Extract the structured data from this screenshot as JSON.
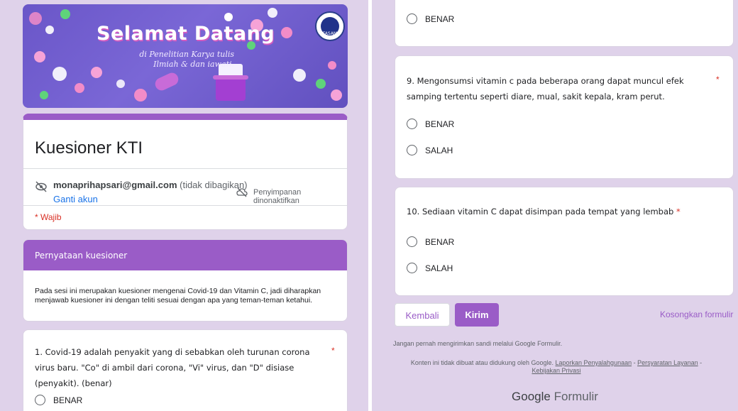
{
  "left": {
    "banner": {
      "title": "Selamat Datang",
      "subtitle": "di Penelitian Karya tulis Ilmiah & dan iawati.",
      "logo_text": "FASAM"
    },
    "form": {
      "title": "Kuesioner KTI",
      "email": "monaprihapsari@gmail.com",
      "shared_note": "(tidak dibagikan)",
      "switch_account": "Ganti akun",
      "save_status": "Penyimpanan dinonaktifkan",
      "required_note": "* Wajib"
    },
    "section": {
      "title": "Pernyataan kuesioner",
      "description": "Pada sesi ini merupakan kuesioner mengenai Covid-19 dan Vitamin C, jadi diharapkan menjawab kuesioner ini dengan teliti sesuai dengan apa yang teman-teman ketahui."
    },
    "question1": {
      "text": "1.   Covid-19 adalah penyakit yang di sebabkan oleh turunan corona virus baru. \"Co\" di ambil dari corona, \"Vi\" virus, dan \"D\" disiase (penyakit). (benar)",
      "required_mark": "*",
      "option1": "BENAR"
    }
  },
  "right": {
    "prev_option": "BENAR",
    "question9": {
      "text": "9.   Mengonsumsi vitamin c pada beberapa orang dapat muncul efek samping tertentu seperti diare, mual, sakit kepala, kram perut.",
      "required_mark": "*",
      "options": [
        "BENAR",
        "SALAH"
      ]
    },
    "question10": {
      "text": "10.  Sediaan vitamin C dapat disimpan pada tempat yang lembab",
      "required_mark": "*",
      "options": [
        "BENAR",
        "SALAH"
      ]
    },
    "buttons": {
      "back": "Kembali",
      "submit": "Kirim",
      "clear": "Kosongkan formulir"
    },
    "footer": {
      "warning": "Jangan pernah mengirimkan sandi melalui Google Formulir.",
      "disclaimer_prefix": "Konten ini tidak dibuat atau didukung oleh Google.",
      "link_abuse": "Laporkan Penyalahgunaan",
      "sep1": " - ",
      "link_terms": "Persyaratan Layanan",
      "sep2": " - ",
      "link_privacy": "Kebijakan Privasi",
      "brand_google": "Google",
      "brand_forms": "Formulir"
    }
  },
  "colors": {
    "background": "#dfd2ea",
    "accent": "#9a5cc7",
    "required": "#d93025",
    "link": "#1a73e8"
  }
}
